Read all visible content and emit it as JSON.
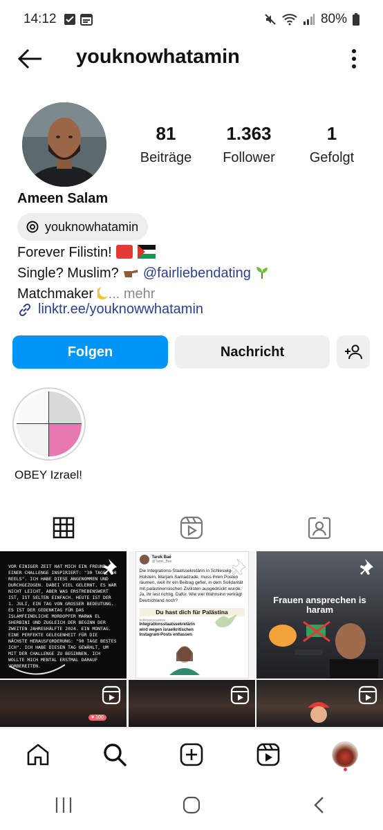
{
  "status_bar": {
    "time": "14:12",
    "battery": "80%",
    "icons": [
      "check-box-icon",
      "calendar-icon",
      "mute-icon",
      "wifi-icon",
      "signal-icon",
      "battery-icon"
    ]
  },
  "header": {
    "username": "youknowhatamin",
    "back_icon": "arrow-left-icon",
    "more_icon": "more-vertical-icon"
  },
  "profile": {
    "stats": [
      {
        "value": "81",
        "label": "Beiträge"
      },
      {
        "value": "1.363",
        "label": "Follower"
      },
      {
        "value": "1",
        "label": "Gefolgt"
      }
    ],
    "full_name": "Ameen Salam",
    "threads_handle": "youknowhatamin",
    "bio": {
      "line1": "Forever Filistin!",
      "line2_prefix": "Single? Muslim?",
      "line2_mention": "@fairliebendating",
      "line3": "Matchmaker",
      "more": "... mehr"
    },
    "link": "linktr.ee/youknowwhatamin"
  },
  "actions": {
    "follow": "Folgen",
    "message": "Nachricht"
  },
  "highlights": [
    {
      "label": "OBEY Izrael!"
    }
  ],
  "tabs": [
    "grid",
    "reels",
    "tagged"
  ],
  "posts": [
    {
      "type": "pinned",
      "text": "VOR EINIGER ZEIT HAT MICH EIN FREUND ZU EINER CHALLENGE INSPIRIERT: \"30 TAGE, 30 REELS\". ICH HABE DIESE ANGENOMMEN UND DURCHGEZOGEN. DABEI VIEL GELERNT. ES WAR NICHT LEICHT, ABER WAS ERSTREBENSWERT IST, IST SELTEN EINFACH. HEUTE IST DER 1. JULI, EIN TAG VON GROSSER BEDEUTUNG. ES IST DER GEDENKTAG FÜR DAS ISLAMFEINDLICHE MORDOPFER MARWA EL SHERBINI UND ZUGLEICH DER BEGINN DER ZWEITEN JAHRESHÄLFTE 2024. EIN MONTAG. EINE PERFEKTE GELEGENHEIT FÜR DIE NÄCHSTE HERAUSFORDERUNG: \"90 TAGE BESTES ICH\". ICH HABE DIESEN TAG GEWÄHLT, UM MIT DER CHALLENGE ZU BEGINNEN. ICH WOLLTE MICH MENTAL ERSTMAL DARAUF VORBEREITEN."
    },
    {
      "type": "pinned",
      "tweet_author": "Tarek Baé",
      "tweet_handle": "@Tarek_Bae",
      "tweet_text": "Die Integrations-Staatssekretärin in Schleswig-Holstein, Marjam Samadzade, muss ihren Posten räumen, weil ihr ein Beitrag gefiel, in dem Solidarität mit palästinensischen Zivilisten ausgedrückt wurde. Ja, ihr lest richtig. Dafür. Wie viel Wahnsinn verträgt Deutschland noch?",
      "overlay": "Du hast dich für Palästina",
      "headline_kicker": "Schleswig-Holstein",
      "headline": "Integrationsstaatssekretärin wird wegen israelkritischen Instagram-Posts entlassen"
    },
    {
      "type": "pinned",
      "caption": "Frauen ansprechen is haram"
    },
    {
      "type": "reel",
      "chat_badge": "♥ 100"
    },
    {
      "type": "reel"
    },
    {
      "type": "reel"
    }
  ],
  "bottom_nav": [
    "home-icon",
    "search-icon",
    "create-icon",
    "reels-icon",
    "profile-avatar"
  ],
  "system_nav": [
    "recents-icon",
    "home-circle-icon",
    "back-chevron-icon"
  ],
  "colors": {
    "primary": "#0095f6",
    "link": "#2c3e8f",
    "secondary_button": "#efefef",
    "notification": "#ff3040"
  }
}
